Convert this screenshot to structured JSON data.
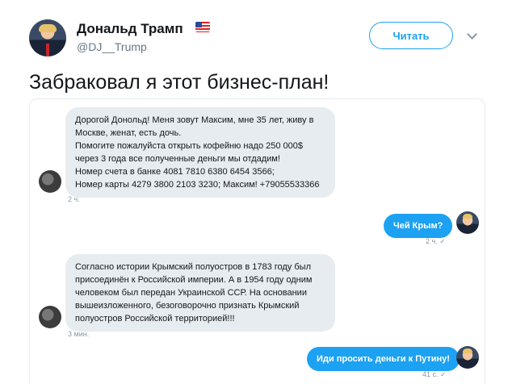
{
  "header": {
    "name": "Дональд Трамп",
    "flag_icon": "us-flag-icon",
    "handle": "@DJ__Trump",
    "follow_label": "Читать"
  },
  "tweet": {
    "text": "Забраковал я этот бизнес-план!"
  },
  "conversation": {
    "msg1_lines": [
      "Дорогой Донольд! Меня зовут Максим, мне 35 лет, живу в",
      "Москве, женат, есть дочь.",
      "Помогите пожалуйста открыть кофейню надо 250 000$",
      "через 3 года все полученные деньги мы отдадим!",
      "Номер счета в банке 4081 7810 6380 6454 3566;",
      "Номер карты 4279 3800 2103 3230; Максим! +79055533366"
    ],
    "msg1_time": "2 ч.",
    "reply1": "Чей Крым?",
    "reply1_time": "2 ч. ✓",
    "msg2_lines": [
      "Согласно истории Крымский полуостров в 1783 году был",
      "присоединён к Российской империи. А в 1954 году одним",
      "человеком был передан Украинской ССР. На основании",
      "вышеизложенного, безоговорочно признать Крымский",
      "полуостров Российской территорией!!!"
    ],
    "msg2_time": "3 мин.",
    "reply2": "Иди просить деньги к Путину!",
    "reply2_time": "41 с. ✓"
  },
  "colors": {
    "accent": "#1da1f2",
    "bubble_in": "#e6ecf0",
    "text": "#14171a",
    "muted": "#657786"
  }
}
